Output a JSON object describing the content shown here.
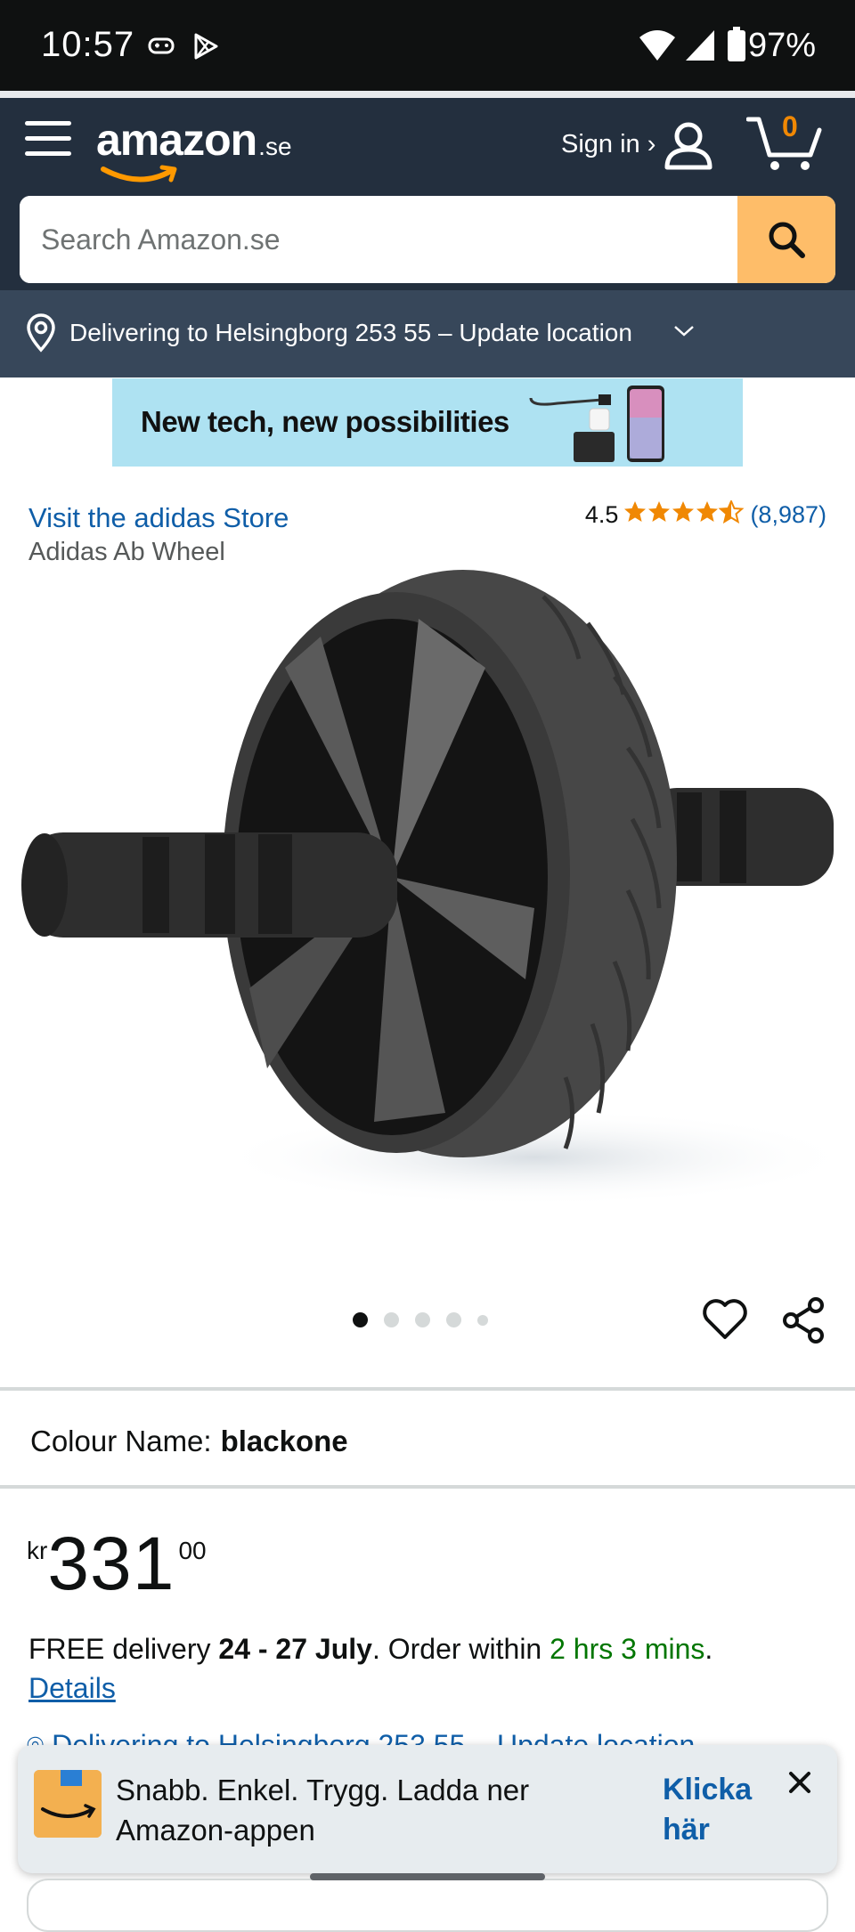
{
  "status_bar": {
    "time": "10:57",
    "battery": "97%",
    "icons": [
      "gamepad-icon",
      "play-store-icon",
      "wifi-icon",
      "signal-icon",
      "battery-icon"
    ]
  },
  "header": {
    "logo_text": "amazon",
    "logo_tld": ".se",
    "sign_in_label": "Sign in ›",
    "cart_count": "0",
    "search_placeholder": "Search Amazon.se"
  },
  "location": {
    "text": "Delivering to Helsingborg 253 55 – Update location"
  },
  "banner": {
    "text": "New tech, new possibilities"
  },
  "product": {
    "store_link": "Visit the adidas Store",
    "title": "Adidas Ab Wheel",
    "rating_value": "4.5",
    "rating_stars": 4.5,
    "rating_count": "(8,987)",
    "image_count": 5,
    "active_image_index": 0,
    "colour_label": "Colour Name:",
    "colour_value": "blackone",
    "price_symbol": "kr",
    "price_whole": "331",
    "price_fraction": "00"
  },
  "delivery": {
    "prefix": "FREE delivery ",
    "dates": "24 - 27 July",
    "middle": ". Order within ",
    "countdown": "2 hrs 3 mins",
    "suffix": ".",
    "details_link": "Details",
    "location_repeat": "Delivering to Helsingborg 253 55 – Update location"
  },
  "app_banner": {
    "text": "Snabb. Enkel. Trygg. Ladda ner Amazon-appen",
    "cta": "Klicka här"
  },
  "colors": {
    "header_bg": "#232f3e",
    "location_bg": "#37475a",
    "search_button": "#febd69",
    "link_blue": "#0f5ea8",
    "star_orange": "#f08804",
    "delivery_green": "#007600"
  }
}
